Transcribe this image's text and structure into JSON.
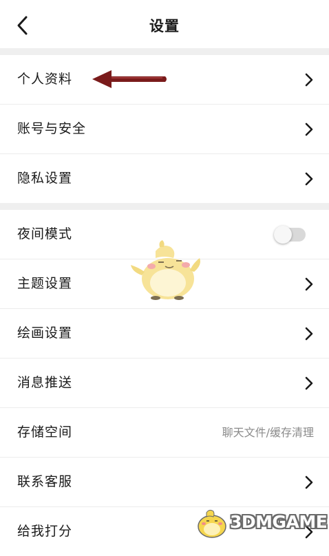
{
  "header": {
    "title": "设置",
    "back_icon": "chevron-left-icon"
  },
  "groups": [
    {
      "items": [
        {
          "label": "个人资料",
          "accessory": "chevron-right-icon"
        },
        {
          "label": "账号与安全",
          "accessory": "chevron-right-icon"
        },
        {
          "label": "隐私设置",
          "accessory": "chevron-right-icon"
        }
      ]
    },
    {
      "items": [
        {
          "label": "夜间模式",
          "accessory": "toggle",
          "toggle_on": false
        },
        {
          "label": "主题设置",
          "accessory": "chevron-right-icon"
        },
        {
          "label": "绘画设置",
          "accessory": "chevron-right-icon"
        },
        {
          "label": "消息推送",
          "accessory": "chevron-right-icon"
        },
        {
          "label": "存储空间",
          "value": "聊天文件/缓存清理"
        },
        {
          "label": "联系客服",
          "accessory": "chevron-right-icon"
        },
        {
          "label": "给我打分",
          "accessory": "chevron-right-icon"
        }
      ]
    }
  ],
  "annotation": {
    "icon": "red-arrow-left-icon",
    "color": "#7a1b1b"
  },
  "mascot": {
    "icon": "yellow-chick-mascot-icon"
  },
  "watermark": {
    "text": "3DMGAME",
    "icon": "chick-logo-icon"
  },
  "colors": {
    "background": "#efefef",
    "card": "#ffffff",
    "divider": "#ececec",
    "text_primary": "#1a1a1a",
    "text_secondary": "#8a8a8a",
    "toggle_off": "#d9d9d9"
  }
}
